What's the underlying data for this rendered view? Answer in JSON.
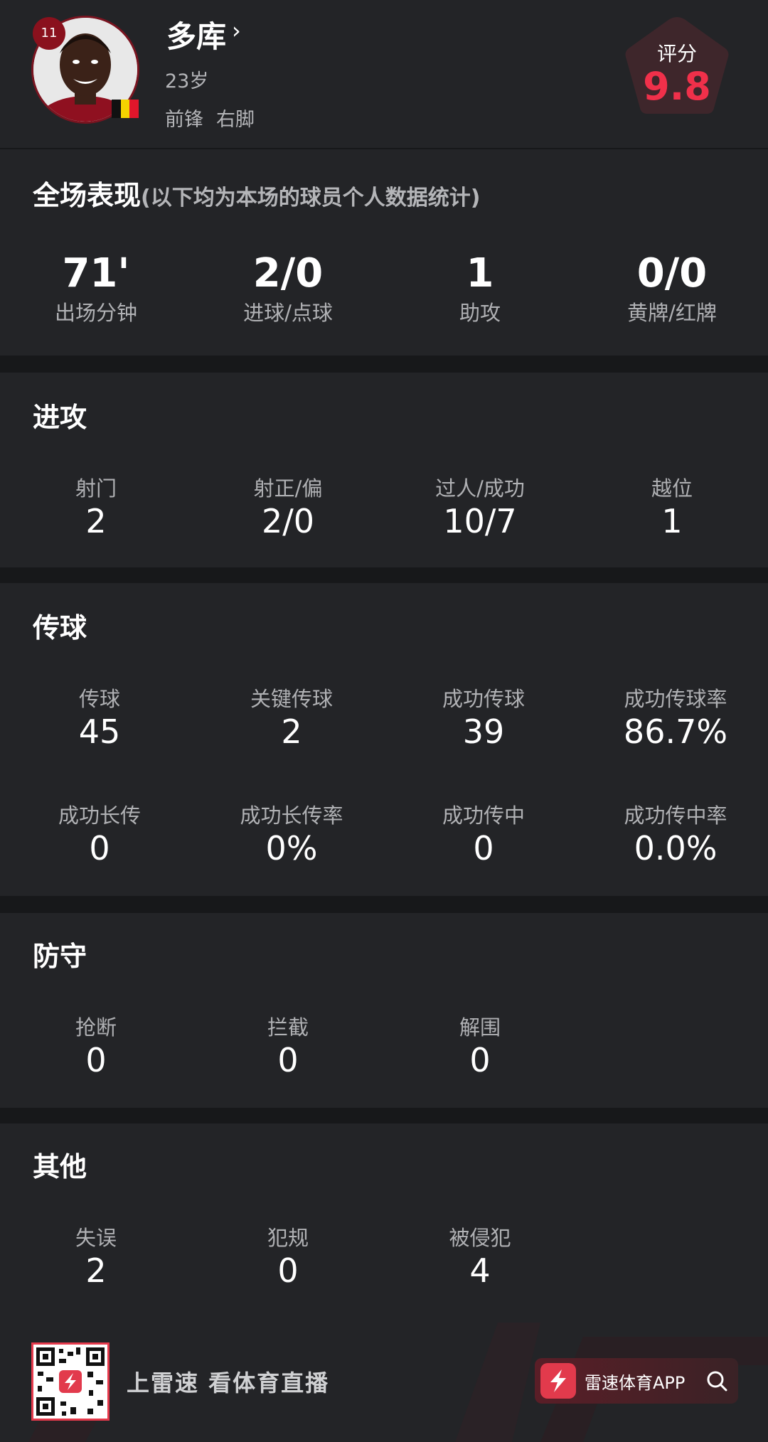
{
  "player": {
    "number": "11",
    "name": "多库",
    "age": "23岁",
    "position": "前锋",
    "foot": "右脚",
    "rating_label": "评分",
    "rating": "9.8",
    "flag_colors": [
      "#111111",
      "#f5d300",
      "#e1162b"
    ]
  },
  "overview": {
    "title": "全场表现",
    "note": "(以下均为本场的球员个人数据统计)",
    "stats": [
      {
        "value": "71'",
        "label": "出场分钟"
      },
      {
        "value": "2/0",
        "label": "进球/点球"
      },
      {
        "value": "1",
        "label": "助攻"
      },
      {
        "value": "0/0",
        "label": "黄牌/红牌"
      }
    ]
  },
  "attack": {
    "title": "进攻",
    "stats": [
      {
        "label": "射门",
        "value": "2"
      },
      {
        "label": "射正/偏",
        "value": "2/0"
      },
      {
        "label": "过人/成功",
        "value": "10/7"
      },
      {
        "label": "越位",
        "value": "1"
      }
    ]
  },
  "passing": {
    "title": "传球",
    "stats": [
      {
        "label": "传球",
        "value": "45"
      },
      {
        "label": "关键传球",
        "value": "2"
      },
      {
        "label": "成功传球",
        "value": "39"
      },
      {
        "label": "成功传球率",
        "value": "86.7%"
      },
      {
        "label": "成功长传",
        "value": "0"
      },
      {
        "label": "成功长传率",
        "value": "0%"
      },
      {
        "label": "成功传中",
        "value": "0"
      },
      {
        "label": "成功传中率",
        "value": "0.0%"
      }
    ]
  },
  "defense": {
    "title": "防守",
    "stats": [
      {
        "label": "抢断",
        "value": "0"
      },
      {
        "label": "拦截",
        "value": "0"
      },
      {
        "label": "解围",
        "value": "0"
      }
    ]
  },
  "other": {
    "title": "其他",
    "stats": [
      {
        "label": "失误",
        "value": "2"
      },
      {
        "label": "犯规",
        "value": "0"
      },
      {
        "label": "被侵犯",
        "value": "4"
      }
    ]
  },
  "footer": {
    "slogan": "上雷速 看体育直播",
    "app_name": "雷速体育APP",
    "accent": "#e23a4c"
  }
}
